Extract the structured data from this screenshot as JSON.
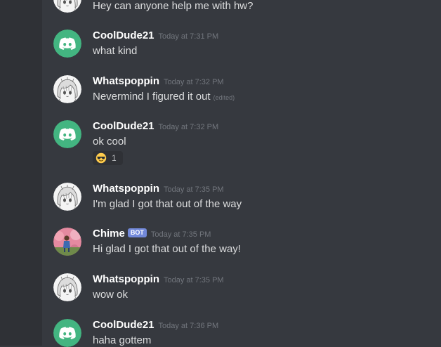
{
  "colors": {
    "background": "#36393f",
    "side_strip": "#2f3136",
    "username": "#ffffff",
    "message_text": "#dcddde",
    "timestamp": "#72767d",
    "bot_badge": "#7289da",
    "default_avatar": "#43b581"
  },
  "messages": [
    {
      "text": "Hey can anyone help me with hw?"
    },
    {
      "author": "CoolDude21",
      "timestamp": "Today at 7:31 PM",
      "text": "what kind",
      "avatar": "discord-default-avatar-icon"
    },
    {
      "author": "Whatspoppin",
      "timestamp": "Today at 7:32 PM",
      "text": "Nevermind I figured it out",
      "edited": "(edited)",
      "avatar": "anime-avatar"
    },
    {
      "author": "CoolDude21",
      "timestamp": "Today at 7:32 PM",
      "text": "ok cool",
      "avatar": "discord-default-avatar-icon",
      "reaction": {
        "emoji": "sunglasses-emoji",
        "count": "1"
      }
    },
    {
      "author": "Whatspoppin",
      "timestamp": "Today at 7:35 PM",
      "text": "I'm glad I got that out of the way",
      "avatar": "anime-avatar"
    },
    {
      "author": "Chime",
      "bot_tag": "BOT",
      "timestamp": "Today at 7:35 PM",
      "text": "Hi glad I got that out of the way!",
      "avatar": "photo-avatar"
    },
    {
      "author": "Whatspoppin",
      "timestamp": "Today at 7:35 PM",
      "text": "wow ok",
      "avatar": "anime-avatar"
    },
    {
      "author": "CoolDude21",
      "timestamp": "Today at 7:36 PM",
      "text": "haha gottem",
      "avatar": "discord-default-avatar-icon"
    }
  ]
}
